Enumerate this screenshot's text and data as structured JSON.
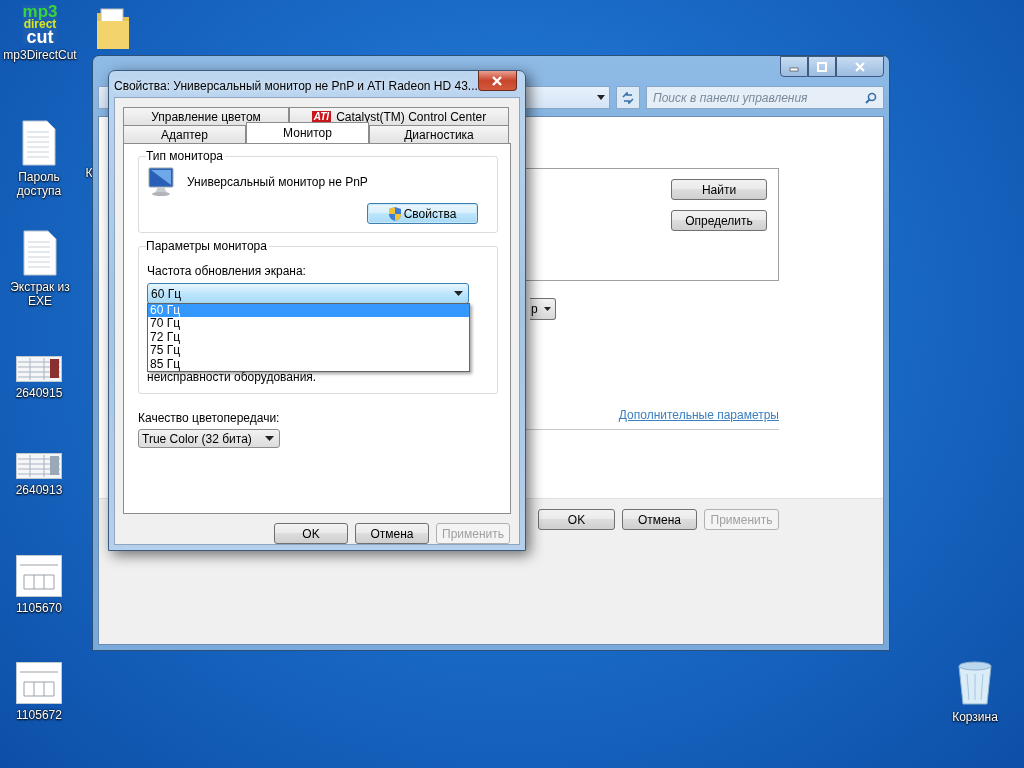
{
  "desktop_icons": [
    {
      "kind": "app",
      "logo": [
        "mp3",
        "direct",
        "cut"
      ],
      "label": "mp3DirectCut"
    },
    {
      "kind": "folder"
    },
    {
      "kind": "document",
      "label": "Пароль доступа"
    },
    {
      "kind": "covered",
      "label": "К"
    },
    {
      "kind": "document",
      "label": "Экстрак из EXE"
    },
    {
      "kind": "sheet",
      "label": "2640915"
    },
    {
      "kind": "sheet",
      "label": "2640913"
    },
    {
      "kind": "drawing",
      "label": "1105670"
    },
    {
      "kind": "drawing",
      "label": "1105672"
    },
    {
      "kind": "recycle",
      "label": "Корзина"
    }
  ],
  "control_panel": {
    "search": {
      "placeholder": "Поиск в панели управления"
    },
    "buttons": [
      "Найти",
      "Определить"
    ],
    "dropdown_fragment": "р",
    "link": "Дополнительные параметры",
    "footer_buttons": [
      {
        "label": "OK",
        "disabled": false
      },
      {
        "label": "Отмена",
        "disabled": false
      },
      {
        "label": "Применить",
        "disabled": true
      }
    ]
  },
  "dialog": {
    "title": "Свойства: Универсальный монитор не PnP и ATI Radeon HD 43...",
    "tab_rows": [
      [
        {
          "label": "Управление цветом",
          "selected": false
        },
        {
          "label": "Catalyst(TM) Control Center",
          "logo": "ATI",
          "selected": false
        }
      ],
      [
        {
          "label": "Адаптер",
          "selected": false
        },
        {
          "label": "Монитор",
          "selected": true
        },
        {
          "label": "Диагностика",
          "selected": false
        }
      ]
    ],
    "monitor_type": {
      "heading": "Тип монитора",
      "name": "Универсальный монитор не PnP",
      "button": "Свойства"
    },
    "monitor_settings": {
      "heading": "Параметры монитора",
      "refresh_label": "Частота обновления экрана:",
      "refresh_value": "60 Гц",
      "options": [
        {
          "label": "60 Гц",
          "selected": true
        },
        {
          "label": "70 Гц",
          "selected": false
        },
        {
          "label": "72 Гц",
          "selected": false
        },
        {
          "label": "75 Гц",
          "selected": false
        },
        {
          "label": "85 Гц",
          "selected": false
        }
      ],
      "warning": [
        "неисправности оборудования."
      ]
    },
    "color_quality": {
      "label": "Качество цветопередачи:",
      "value": "True Color (32 бита)"
    },
    "buttons": [
      {
        "label": "OK",
        "disabled": false
      },
      {
        "label": "Отмена",
        "disabled": false
      },
      {
        "label": "Применить",
        "disabled": true
      }
    ]
  }
}
